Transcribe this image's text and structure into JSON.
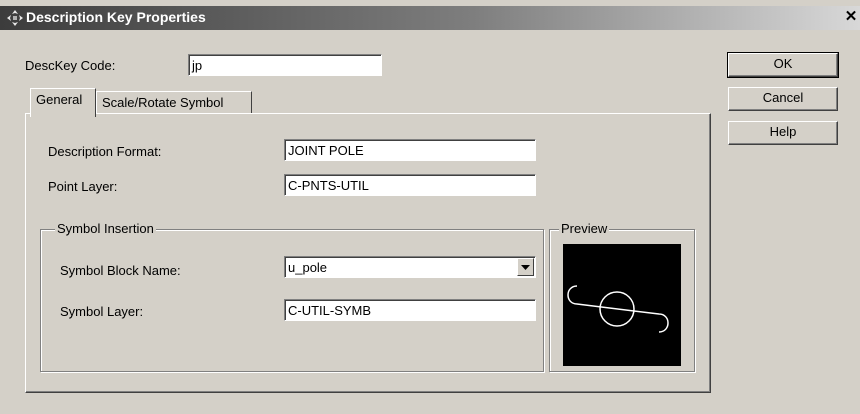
{
  "window": {
    "title": "Description Key Properties",
    "close_symbol": "✕"
  },
  "desckey": {
    "label": "DescKey Code:",
    "value": "jp"
  },
  "buttons": {
    "ok": "OK",
    "cancel": "Cancel",
    "help": "Help"
  },
  "tabs": [
    {
      "label": "General",
      "active": true
    },
    {
      "label": "Scale/Rotate Symbol",
      "active": false
    }
  ],
  "general": {
    "description_format": {
      "label": "Description Format:",
      "value": "JOINT POLE"
    },
    "point_layer": {
      "label": "Point Layer:",
      "value": "C-PNTS-UTIL"
    }
  },
  "symbol_insertion": {
    "group_label": "Symbol Insertion",
    "block_name": {
      "label": "Symbol Block Name:",
      "value": "u_pole",
      "dropdown_icon": "chevron-down-icon"
    },
    "layer": {
      "label": "Symbol Layer:",
      "value": "C-UTIL-SYMB"
    }
  },
  "preview": {
    "label": "Preview",
    "symbol": "pole-symbol"
  },
  "colors": {
    "title_start": "#3c3c3c",
    "title_end": "#d8d8d8",
    "face": "#d4d0c8",
    "preview_bg": "#000000"
  }
}
